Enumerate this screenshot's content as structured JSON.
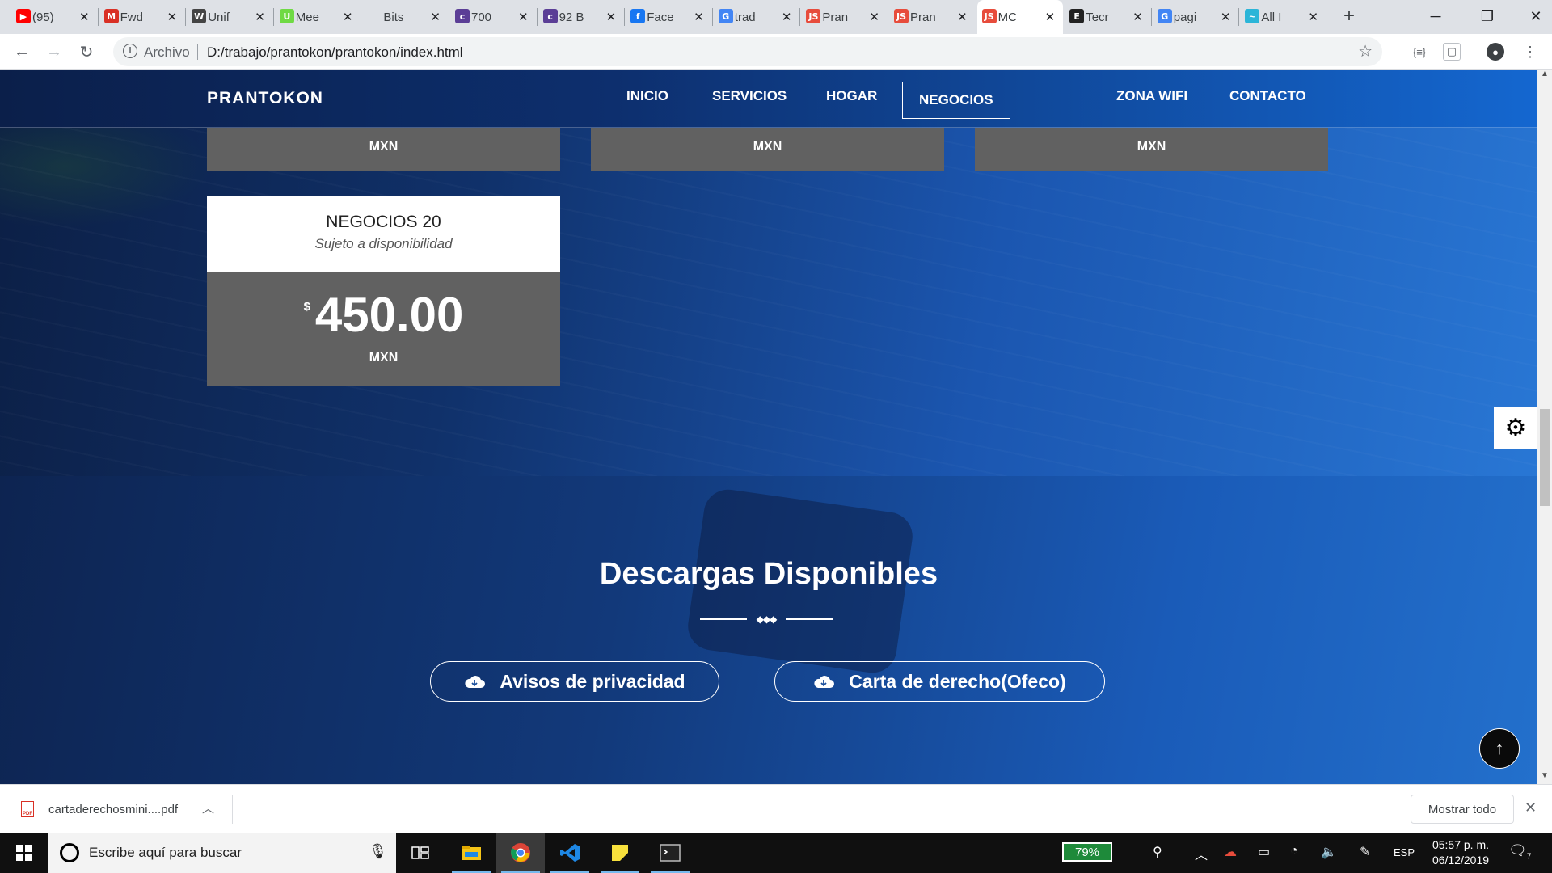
{
  "browser": {
    "tabs": [
      {
        "label": "(95)",
        "favicon": "youtube-icon",
        "color": "#ff0000",
        "glyph": "▶"
      },
      {
        "label": "Fwd",
        "favicon": "gmail-icon",
        "color": "#d93025",
        "glyph": "M"
      },
      {
        "label": "Unif",
        "favicon": "w-icon",
        "color": "#444444",
        "glyph": "W"
      },
      {
        "label": "Mee",
        "favicon": "upwork-icon",
        "color": "#6fda44",
        "glyph": "U"
      },
      {
        "label": "Bits",
        "favicon": "blank-icon",
        "color": "#dee1e6",
        "glyph": ""
      },
      {
        "label": "700",
        "favicon": "colorlib-icon",
        "color": "#5b3e96",
        "glyph": "c"
      },
      {
        "label": "92 B",
        "favicon": "colorlib-icon",
        "color": "#5b3e96",
        "glyph": "c"
      },
      {
        "label": "Face",
        "favicon": "facebook-icon",
        "color": "#1877f2",
        "glyph": "f"
      },
      {
        "label": "trad",
        "favicon": "google-icon",
        "color": "#4285f4",
        "glyph": "G"
      },
      {
        "label": "Pran",
        "favicon": "js-icon",
        "color": "#e74c3c",
        "glyph": "JS"
      },
      {
        "label": "Pran",
        "favicon": "js-icon",
        "color": "#e74c3c",
        "glyph": "JS"
      },
      {
        "label": "MC",
        "favicon": "js-icon",
        "color": "#e74c3c",
        "glyph": "JS"
      },
      {
        "label": "Tecr",
        "favicon": "e-icon",
        "color": "#222222",
        "glyph": "E"
      },
      {
        "label": "pagi",
        "favicon": "google-icon",
        "color": "#4285f4",
        "glyph": "G"
      },
      {
        "label": "All I",
        "favicon": "bird-icon",
        "color": "#2bb5d8",
        "glyph": "~"
      }
    ],
    "active_tab_index": 11,
    "url_scheme": "Archivo",
    "url": "D:/trabajo/prantokon/prantokon/index.html"
  },
  "site": {
    "logo": "PRANTOKON",
    "nav": [
      "INICIO",
      "SERVICIOS",
      "HOGAR",
      "NEGOCIOS",
      "ZONA WIFI",
      "CONTACTO"
    ],
    "active_nav": "NEGOCIOS",
    "partial_cards": [
      "MXN",
      "MXN",
      "MXN"
    ],
    "card": {
      "title": "NEGOCIOS 20",
      "subtitle": "Sujeto a disponibilidad",
      "currency_symbol": "$",
      "price": "450.00",
      "unit": "MXN"
    },
    "downloads": {
      "title": "Descargas Disponibles",
      "buttons": [
        "Avisos de privacidad",
        "Carta de derecho(Ofeco)"
      ]
    }
  },
  "shelf": {
    "file": "cartaderechosmini....pdf",
    "show_all": "Mostrar todo"
  },
  "taskbar": {
    "search_placeholder": "Escribe aquí para buscar",
    "battery": "79%",
    "language": "ESP",
    "time": "05:57 p. m.",
    "date": "06/12/2019",
    "notifications": "7"
  }
}
